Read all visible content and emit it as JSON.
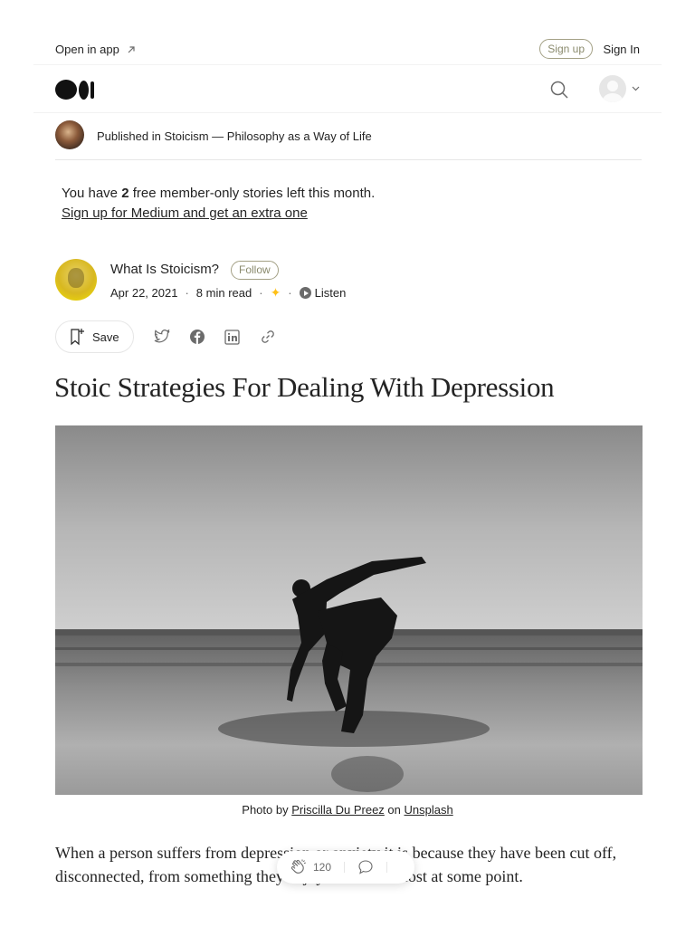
{
  "topbar": {
    "open_in_app": "Open in app",
    "sign_up": "Sign up",
    "sign_in": "Sign In"
  },
  "navbar": {
    "logo_icon": "medium-logo",
    "search_icon": "search-icon",
    "avatar_icon": "user-avatar"
  },
  "publication": {
    "prefix": "Published in ",
    "name": "Stoicism — Philosophy as a Way of Life"
  },
  "member_notice": {
    "text_before": "You have ",
    "count": "2",
    "text_after": " free member-only stories left this month.",
    "link": "Sign up for Medium and get an extra one"
  },
  "author": {
    "name": "What Is Stoicism?",
    "follow": "Follow",
    "date": "Apr 22, 2021",
    "read_time": "8 min read",
    "listen": "Listen"
  },
  "actions": {
    "save": "Save",
    "icons": [
      "bookmark-icon",
      "twitter-icon",
      "facebook-icon",
      "linkedin-icon",
      "link-icon"
    ]
  },
  "article": {
    "title": "Stoic Strategies For Dealing With Depression",
    "caption_prefix": "Photo by ",
    "caption_author": "Priscilla Du Preez",
    "caption_mid": " on ",
    "caption_source": "Unsplash",
    "paragraph": "When a person suffers from depression or anxiety it is because they have been cut off, disconnected, from something they enjoyed but have lost at some point."
  },
  "floating_bar": {
    "claps": "120",
    "icons": [
      "clap-icon",
      "comment-icon"
    ]
  },
  "colors": {
    "accent_pill_border": "#a3a085",
    "text": "#242424",
    "muted": "#6b6b6b",
    "member_star": "#ffc017"
  }
}
